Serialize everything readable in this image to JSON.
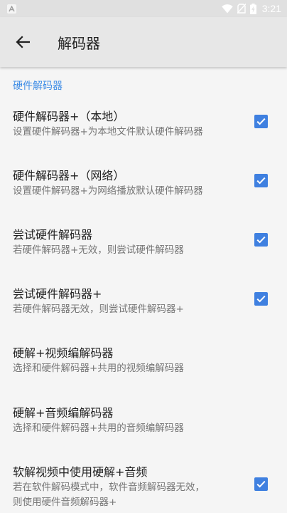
{
  "status_bar": {
    "time": "3:21",
    "notification_icon": "a-notification-icon",
    "icons": [
      "wifi-icon",
      "no-sim-icon",
      "battery-charging-icon"
    ]
  },
  "app_bar": {
    "back_icon": "arrow-back-icon",
    "title": "解码器"
  },
  "section": {
    "header": "硬件解码器"
  },
  "preferences": [
    {
      "title": "硬件解码器+（本地）",
      "summary": "设置硬件解码器+为本地文件默认硬件解码器",
      "checkbox": true,
      "checked": true
    },
    {
      "title": "硬件解码器+（网络）",
      "summary": "设置硬件解码器+为网络播放默认硬件解码器",
      "checkbox": true,
      "checked": true
    },
    {
      "title": "尝试硬件解码器",
      "summary": "若硬件解码器+无效，则尝试硬件解码器",
      "checkbox": true,
      "checked": true
    },
    {
      "title": "尝试硬件解码器+",
      "summary": "若硬件解码器无效，则尝试硬件解码器+",
      "checkbox": true,
      "checked": true
    },
    {
      "title": "硬解+视频编解码器",
      "summary": "选择和硬件解码器+共用的视频编解码器",
      "checkbox": false
    },
    {
      "title": "硬解+音频编解码器",
      "summary": "选择和硬件解码器+共用的音频编解码器",
      "checkbox": false
    },
    {
      "title": "软解视频中使用硬解+音频",
      "summary": "若在软件解码模式中，软件音频解码器无效，",
      "summary_line2": "则使用硬件音频解码器+",
      "checkbox": true,
      "checked": true
    }
  ],
  "colors": {
    "accent": "#3f80e0",
    "section_header": "#3f8de6",
    "status_bar": "#e0e0e0",
    "app_bar": "#e7e7e7",
    "background": "#f5f5f5"
  }
}
